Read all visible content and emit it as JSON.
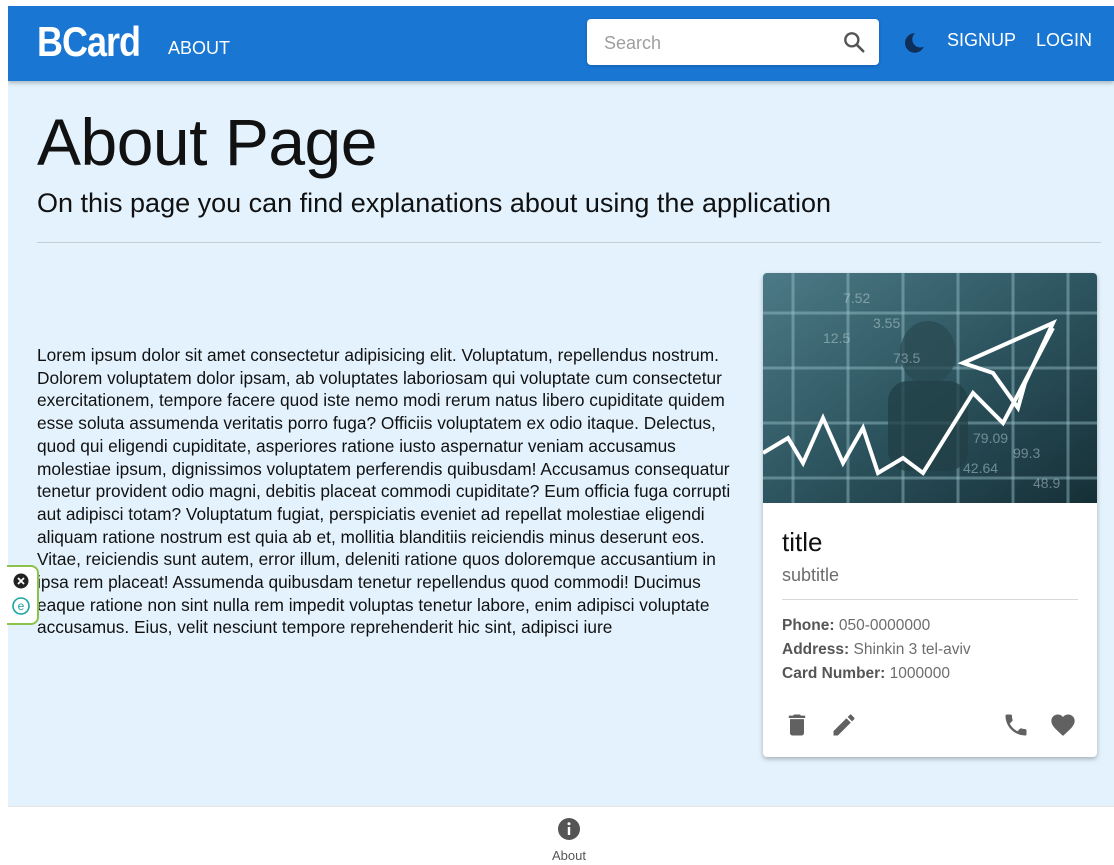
{
  "header": {
    "logo": "BCard",
    "nav_about": "ABOUT",
    "search_placeholder": "Search",
    "nav_signup": "SIGNUP",
    "nav_login": "LOGIN",
    "icons": [
      "search-icon",
      "dark-mode-moon-icon"
    ]
  },
  "page": {
    "title": "About Page",
    "subtitle": "On this page you can find explanations about using the application",
    "body": "Lorem ipsum dolor sit amet consectetur adipisicing elit. Voluptatum, repellendus nostrum. Dolorem voluptatem dolor ipsam, ab voluptates laboriosam qui voluptate cum consectetur exercitationem, tempore facere quod iste nemo modi rerum natus libero cupiditate quidem esse soluta assumenda veritatis porro fuga? Officiis voluptatem ex odio itaque. Delectus, quod qui eligendi cupiditate, asperiores ratione iusto aspernatur veniam accusamus molestiae ipsum, dignissimos voluptatem perferendis quibusdam! Accusamus consequatur tenetur provident odio magni, debitis placeat commodi cupiditate? Eum officia fuga corrupti aut adipisci totam? Voluptatum fugiat, perspiciatis eveniet ad repellat molestiae eligendi aliquam ratione nostrum est quia ab et, mollitia blanditiis reiciendis minus deserunt eos. Vitae, reiciendis sunt autem, error illum, deleniti ratione quos doloremque accusantium in ipsa rem placeat! Assumenda quibusdam tenetur repellendus quod commodi! Ducimus eaque ratione non sint nulla rem impedit voluptas tenetur labore, enim adipisci voluptate accusamus. Eius, velit nesciunt tempore reprehenderit hic sint, adipisci iure"
  },
  "card": {
    "title": "title",
    "subtitle": "subtitle",
    "phone_label": "Phone:",
    "phone": "050-0000000",
    "address_label": "Address:",
    "address": "Shinkin 3 tel-aviv",
    "card_number_label": "Card Number:",
    "card_number": "1000000",
    "icons": [
      "delete-icon",
      "edit-icon",
      "phone-icon",
      "favorite-heart-icon"
    ]
  },
  "bottom_nav": {
    "about_label": "About",
    "icon": "info-icon"
  },
  "colors": {
    "appbar": "#1976d2",
    "page_background": "#e3f2fd",
    "card_background": "#ffffff",
    "extension_border": "#8bc34a"
  }
}
